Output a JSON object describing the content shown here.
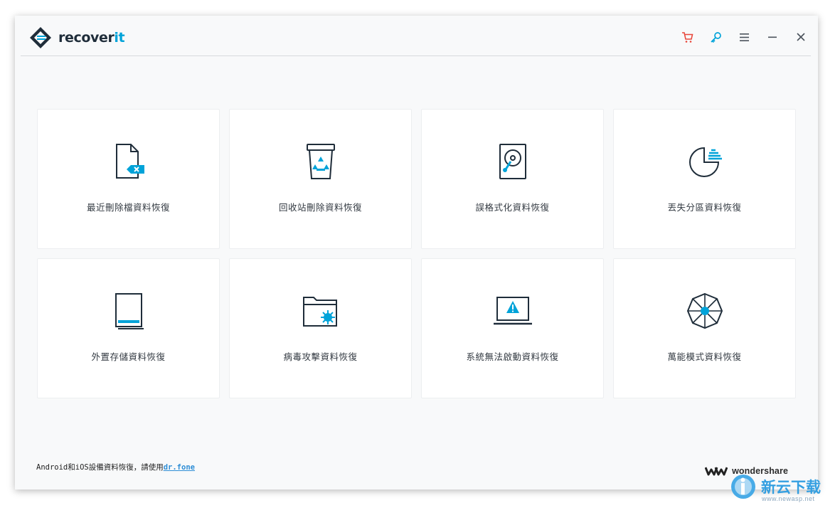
{
  "app": {
    "logo_main": "recover",
    "logo_accent": "it"
  },
  "titlebar": {
    "controls": [
      "cart-icon",
      "key-icon",
      "menu-icon",
      "minimize-icon",
      "close-icon"
    ],
    "accent_color": "#00a3d9",
    "cart_color": "#e8473b"
  },
  "cards": [
    {
      "label": "最近刪除檔資料恢復",
      "icon": "deleted-file-icon"
    },
    {
      "label": "回收站刪除資料恢復",
      "icon": "recycle-bin-icon"
    },
    {
      "label": "誤格式化資料恢復",
      "icon": "hard-drive-icon"
    },
    {
      "label": "丟失分區資料恢復",
      "icon": "partition-icon"
    },
    {
      "label": "外置存儲資料恢復",
      "icon": "external-device-icon"
    },
    {
      "label": "病毒攻擊資料恢復",
      "icon": "virus-folder-icon"
    },
    {
      "label": "系統無法啟動資料恢復",
      "icon": "system-crash-icon"
    },
    {
      "label": "萬能模式資料恢復",
      "icon": "all-around-icon"
    }
  ],
  "footer": {
    "note": "Android和iOS設備資料恢復，請使用",
    "link": "dr.fone",
    "brand": "wondershare"
  },
  "watermark": {
    "text": "新云下载",
    "url": "www.newasp.net"
  }
}
